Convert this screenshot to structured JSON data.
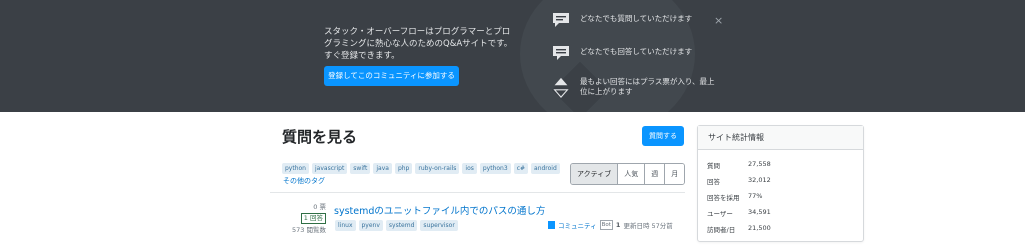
{
  "hero": {
    "description": "スタック・オーバーフローはプログラマーとプログラミングに熱心な人のためのQ&Aサイトです。すぐ登録できます。",
    "cta_label": "登録してこのコミュニティに参加する",
    "features": [
      {
        "icon": "speech-bubble-icon",
        "text": "どなたでも質問していただけます"
      },
      {
        "icon": "answer-bubble-icon",
        "text": "どなたでも回答していただけます"
      },
      {
        "icon": "vote-arrows-icon",
        "text": "最もよい回答にはプラス票が入り、最上位に上がります"
      }
    ],
    "close_label": "×"
  },
  "main": {
    "title": "質問を見る",
    "ask_label": "質問する",
    "tags": [
      "python",
      "javascript",
      "swift",
      "java",
      "php",
      "ruby-on-rails",
      "ios",
      "python3",
      "c#",
      "android"
    ],
    "tags_link": "その他のタグ",
    "filters": [
      "アクティブ",
      "人気",
      "週",
      "月"
    ],
    "active_filter": "アクティブ"
  },
  "question": {
    "votes": "0 票",
    "answers": "1 回答",
    "views": "573 閲覧数",
    "title": "systemdのユニットファイル内でのパスの通し方",
    "tags": [
      "linux",
      "pyenv",
      "systemd",
      "supervisor"
    ],
    "user": "コミュニティ",
    "bot_badge": "Bot",
    "reputation": "1",
    "modified": "更新日時 57分前"
  },
  "sidebar": {
    "title": "サイト統計情報",
    "stats": [
      {
        "label": "質問",
        "value": "27,558"
      },
      {
        "label": "回答",
        "value": "32,012"
      },
      {
        "label": "回答を採用",
        "value": "77%"
      },
      {
        "label": "ユーザー",
        "value": "34,591"
      },
      {
        "label": "訪問者/日",
        "value": "21,500"
      }
    ]
  },
  "colors": {
    "hero_bg": "#3b4046",
    "accent": "#0a95ff",
    "tag_bg": "#e1ecf4",
    "tag_text": "#39739d",
    "link": "#0074cc",
    "answered": "#2f6f44"
  }
}
